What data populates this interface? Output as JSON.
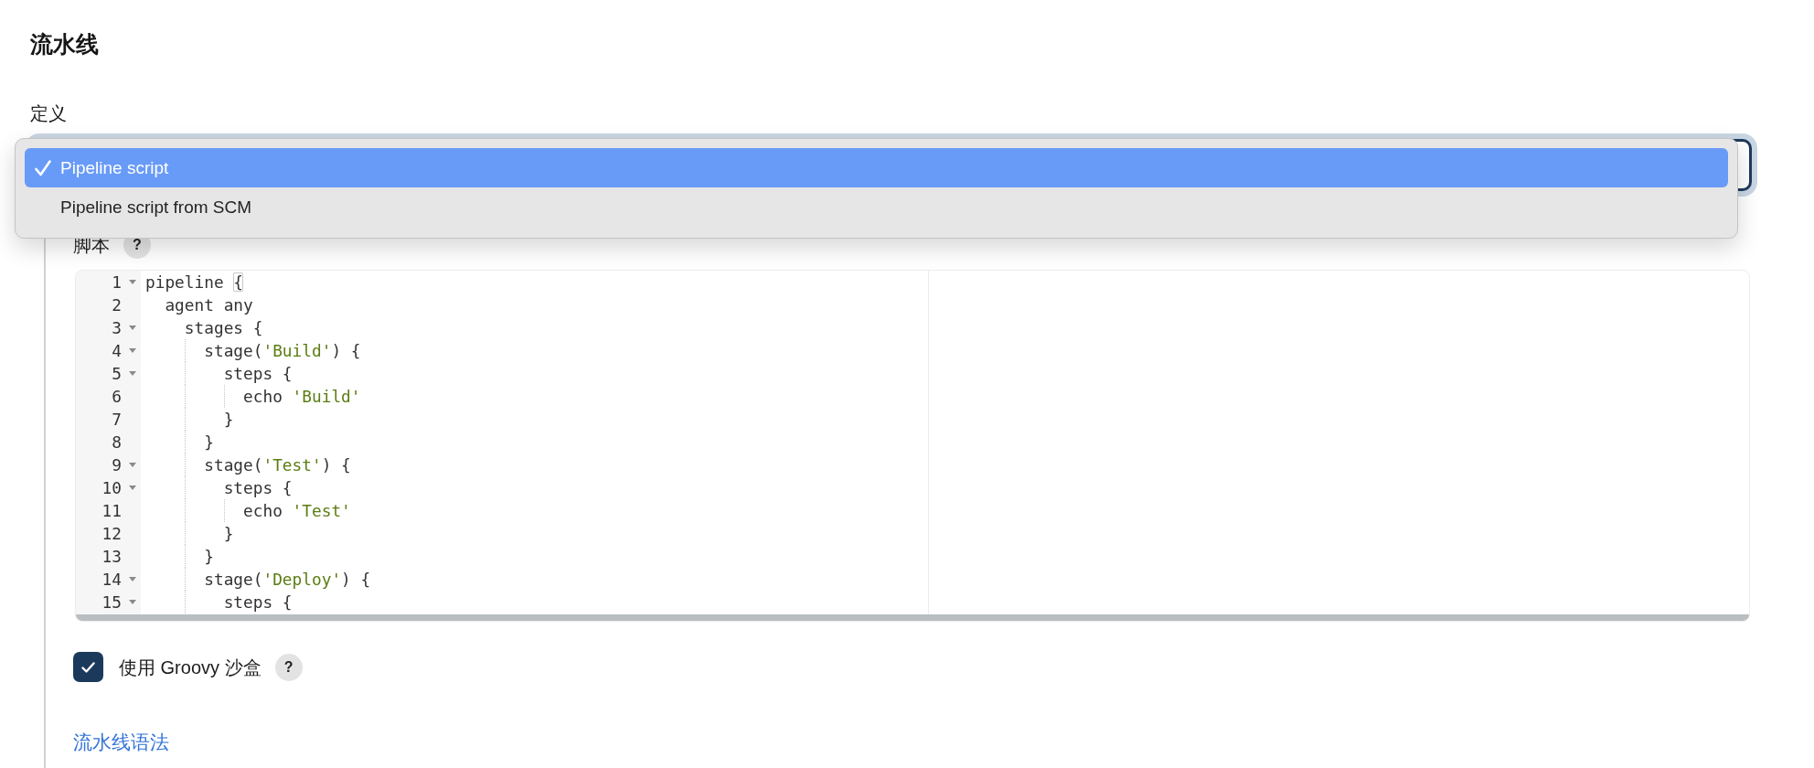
{
  "heading": "流水线",
  "definition": {
    "label": "定义",
    "select": {
      "open": true,
      "options": [
        {
          "label": "Pipeline script",
          "selected": true
        },
        {
          "label": "Pipeline script from SCM",
          "selected": false
        }
      ]
    }
  },
  "script": {
    "label": "脚本",
    "help": "?",
    "editor": {
      "lines": [
        {
          "number": "1",
          "foldable": true,
          "tokens": [
            {
              "kind": "text",
              "text": "pipeline "
            },
            {
              "kind": "bracket_match",
              "text": "{"
            }
          ]
        },
        {
          "number": "2",
          "foldable": false,
          "tokens": [
            {
              "kind": "text",
              "text": "  agent any"
            }
          ]
        },
        {
          "number": "3",
          "foldable": true,
          "tokens": [
            {
              "kind": "text",
              "text": "    stages {"
            }
          ]
        },
        {
          "number": "4",
          "foldable": true,
          "tokens": [
            {
              "kind": "text",
              "text": "      stage("
            },
            {
              "kind": "string",
              "text": "'Build'"
            },
            {
              "kind": "text",
              "text": ") {"
            }
          ]
        },
        {
          "number": "5",
          "foldable": true,
          "tokens": [
            {
              "kind": "text",
              "text": "        steps {"
            }
          ]
        },
        {
          "number": "6",
          "foldable": false,
          "tokens": [
            {
              "kind": "text",
              "text": "          echo "
            },
            {
              "kind": "string",
              "text": "'Build'"
            }
          ]
        },
        {
          "number": "7",
          "foldable": false,
          "tokens": [
            {
              "kind": "text",
              "text": "        }"
            }
          ]
        },
        {
          "number": "8",
          "foldable": false,
          "tokens": [
            {
              "kind": "text",
              "text": "      }"
            }
          ]
        },
        {
          "number": "9",
          "foldable": true,
          "tokens": [
            {
              "kind": "text",
              "text": "      stage("
            },
            {
              "kind": "string",
              "text": "'Test'"
            },
            {
              "kind": "text",
              "text": ") {"
            }
          ]
        },
        {
          "number": "10",
          "foldable": true,
          "tokens": [
            {
              "kind": "text",
              "text": "        steps {"
            }
          ]
        },
        {
          "number": "11",
          "foldable": false,
          "tokens": [
            {
              "kind": "text",
              "text": "          echo "
            },
            {
              "kind": "string",
              "text": "'Test'"
            }
          ]
        },
        {
          "number": "12",
          "foldable": false,
          "tokens": [
            {
              "kind": "text",
              "text": "        }"
            }
          ]
        },
        {
          "number": "13",
          "foldable": false,
          "tokens": [
            {
              "kind": "text",
              "text": "      }"
            }
          ]
        },
        {
          "number": "14",
          "foldable": true,
          "tokens": [
            {
              "kind": "text",
              "text": "      stage("
            },
            {
              "kind": "string",
              "text": "'Deploy'"
            },
            {
              "kind": "text",
              "text": ") {"
            }
          ]
        },
        {
          "number": "15",
          "foldable": true,
          "tokens": [
            {
              "kind": "text",
              "text": "        steps {"
            }
          ]
        }
      ]
    }
  },
  "sandbox": {
    "label": "使用 Groovy 沙盒",
    "checked": true,
    "help": "?"
  },
  "syntax_link": "流水线语法"
}
